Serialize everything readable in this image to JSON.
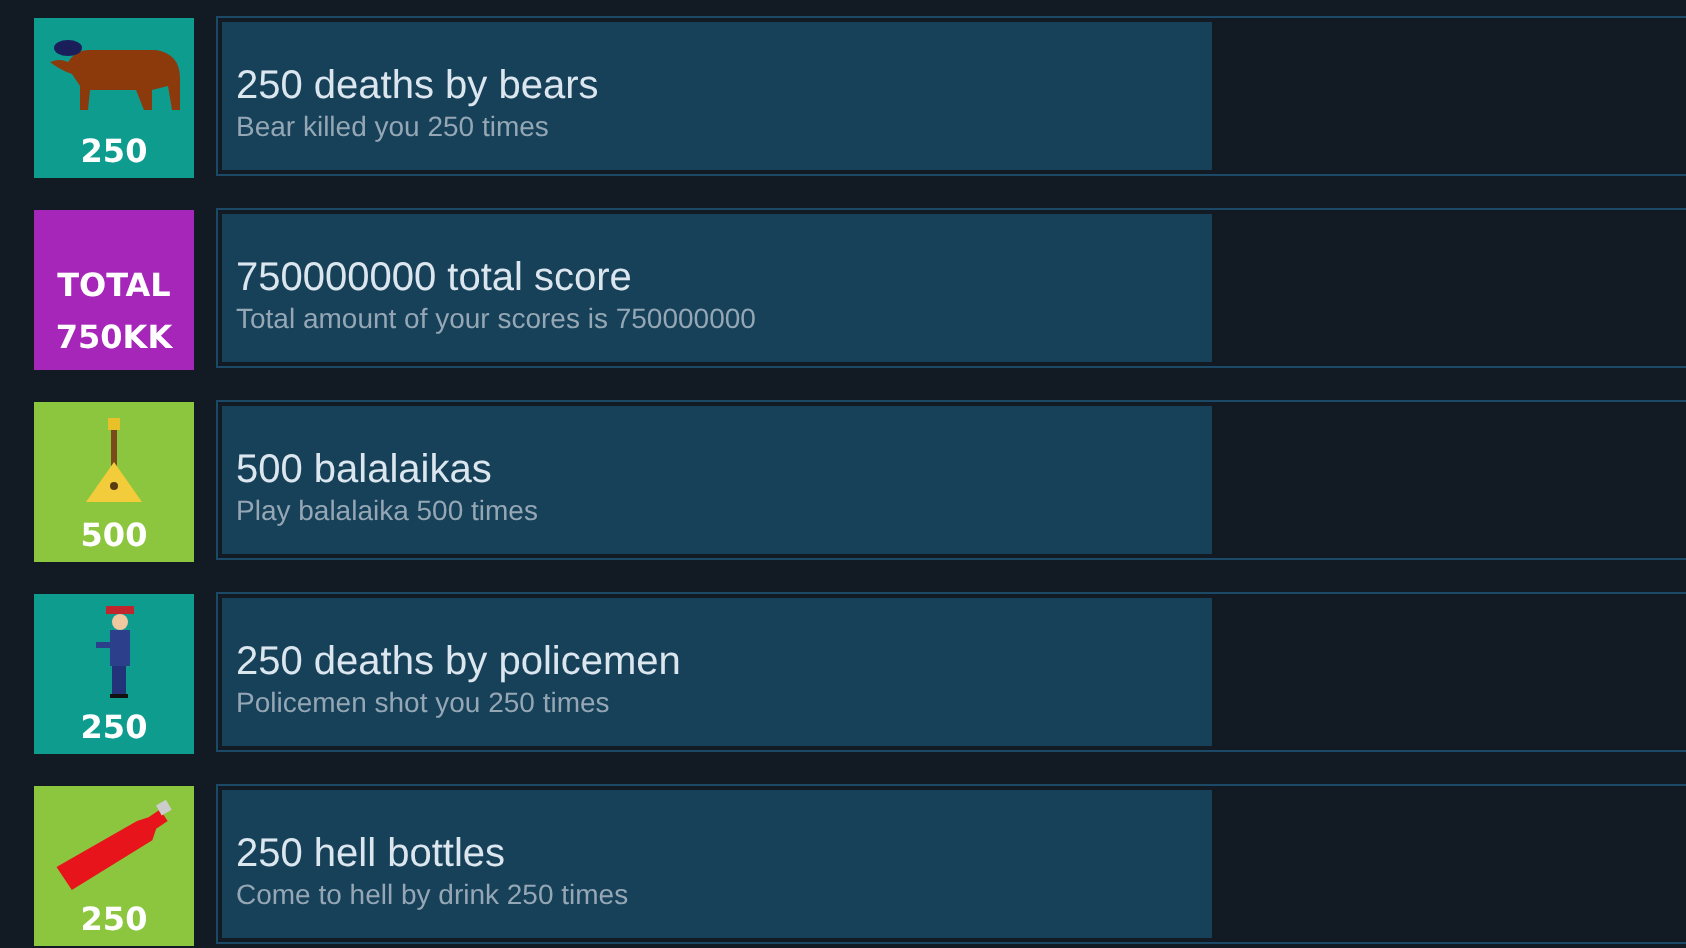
{
  "achievements": [
    {
      "icon": {
        "kind": "bear",
        "color": "#0e9c8f",
        "lines": [
          "250"
        ]
      },
      "title": "250 deaths by bears",
      "description": "Bear killed you 250 times"
    },
    {
      "icon": {
        "kind": "text",
        "color": "#a526b8",
        "lines": [
          "TOTAL",
          "750KK"
        ]
      },
      "title": "750000000 total score",
      "description": "Total amount of your scores is 750000000"
    },
    {
      "icon": {
        "kind": "balalaika",
        "color": "#8cc63f",
        "lines": [
          "500"
        ]
      },
      "title": "500 balalaikas",
      "description": "Play balalaika 500 times"
    },
    {
      "icon": {
        "kind": "policeman",
        "color": "#0e9c8f",
        "lines": [
          "250"
        ]
      },
      "title": "250 deaths by policemen",
      "description": "Policemen shot you 250 times"
    },
    {
      "icon": {
        "kind": "bottle",
        "color": "#8cc63f",
        "lines": [
          "250"
        ]
      },
      "title": "250 hell bottles",
      "description": "Come to hell by drink 250 times"
    }
  ]
}
